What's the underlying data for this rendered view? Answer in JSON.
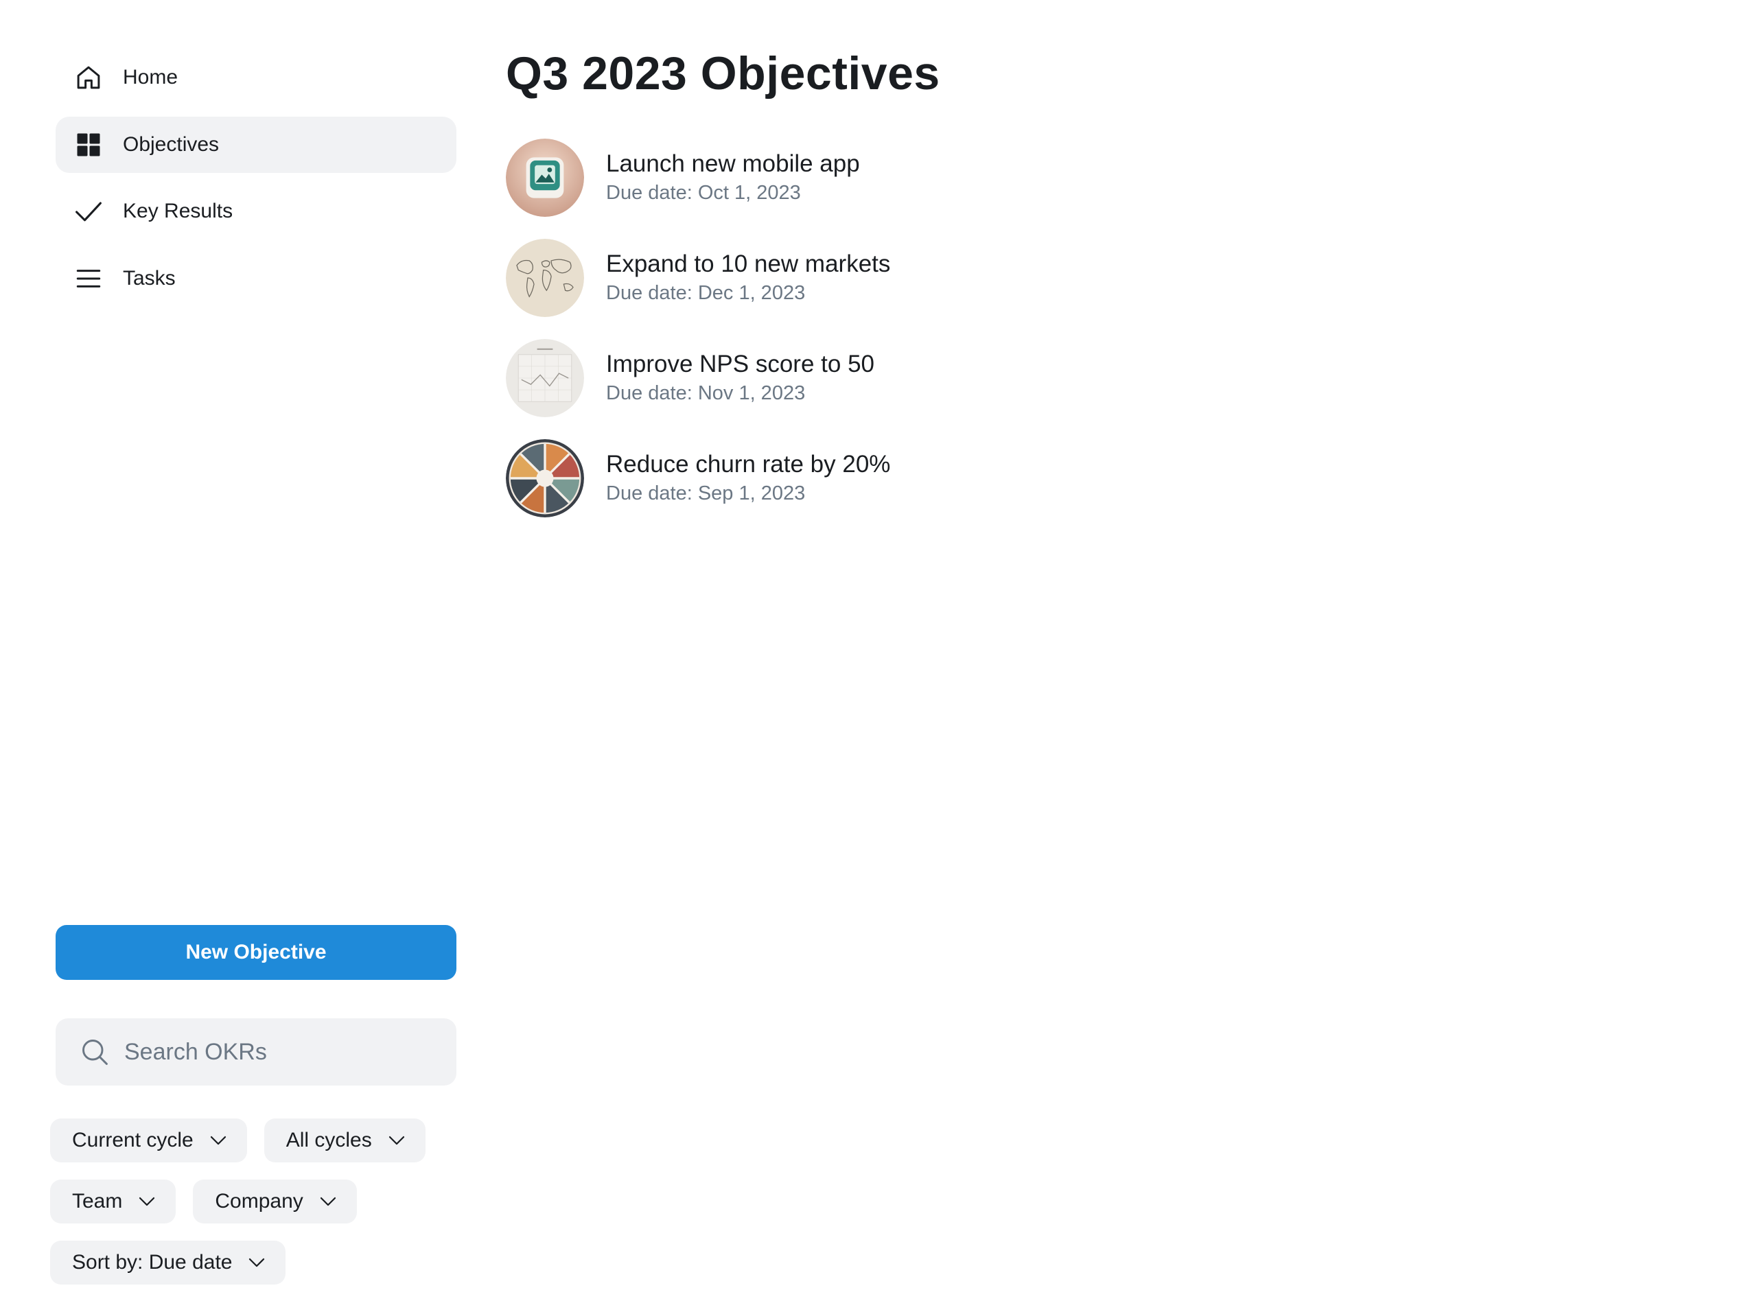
{
  "sidebar": {
    "nav": [
      {
        "label": "Home",
        "icon": "home-icon",
        "active": false
      },
      {
        "label": "Objectives",
        "icon": "grid-icon",
        "active": true
      },
      {
        "label": "Key Results",
        "icon": "check-icon",
        "active": false
      },
      {
        "label": "Tasks",
        "icon": "list-icon",
        "active": false
      }
    ],
    "new_objective_label": "New Objective",
    "search": {
      "placeholder": "Search OKRs",
      "value": ""
    },
    "filters": [
      {
        "label": "Current cycle"
      },
      {
        "label": "All cycles"
      },
      {
        "label": "Team"
      },
      {
        "label": "Company"
      },
      {
        "label": "Sort by: Due date"
      }
    ]
  },
  "main": {
    "title": "Q3 2023 Objectives",
    "objectives": [
      {
        "title": "Launch new mobile app",
        "due": "Due date: Oct 1, 2023",
        "thumbnail": "mobile-app-icon"
      },
      {
        "title": "Expand to 10 new markets",
        "due": "Due date: Dec 1, 2023",
        "thumbnail": "world-map-image"
      },
      {
        "title": "Improve NPS score to 50",
        "due": "Due date: Nov 1, 2023",
        "thumbnail": "line-chart-image"
      },
      {
        "title": "Reduce churn rate by 20%",
        "due": "Due date: Sep 1, 2023",
        "thumbnail": "color-wheel-image"
      }
    ]
  },
  "colors": {
    "accent": "#1f8ad9",
    "active_bg": "#f1f2f4",
    "text": "#1a1d21",
    "muted_text": "#6b7784"
  }
}
